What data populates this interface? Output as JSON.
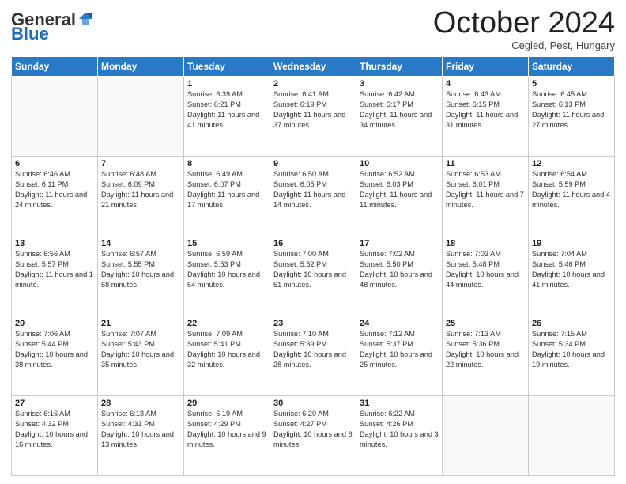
{
  "header": {
    "logo_general": "General",
    "logo_blue": "Blue",
    "month_title": "October 2024",
    "subtitle": "Cegled, Pest, Hungary"
  },
  "weekdays": [
    "Sunday",
    "Monday",
    "Tuesday",
    "Wednesday",
    "Thursday",
    "Friday",
    "Saturday"
  ],
  "weeks": [
    [
      {
        "day": "",
        "sunrise": "",
        "sunset": "",
        "daylight": ""
      },
      {
        "day": "",
        "sunrise": "",
        "sunset": "",
        "daylight": ""
      },
      {
        "day": "1",
        "sunrise": "Sunrise: 6:39 AM",
        "sunset": "Sunset: 6:21 PM",
        "daylight": "Daylight: 11 hours and 41 minutes."
      },
      {
        "day": "2",
        "sunrise": "Sunrise: 6:41 AM",
        "sunset": "Sunset: 6:19 PM",
        "daylight": "Daylight: 11 hours and 37 minutes."
      },
      {
        "day": "3",
        "sunrise": "Sunrise: 6:42 AM",
        "sunset": "Sunset: 6:17 PM",
        "daylight": "Daylight: 11 hours and 34 minutes."
      },
      {
        "day": "4",
        "sunrise": "Sunrise: 6:43 AM",
        "sunset": "Sunset: 6:15 PM",
        "daylight": "Daylight: 11 hours and 31 minutes."
      },
      {
        "day": "5",
        "sunrise": "Sunrise: 6:45 AM",
        "sunset": "Sunset: 6:13 PM",
        "daylight": "Daylight: 11 hours and 27 minutes."
      }
    ],
    [
      {
        "day": "6",
        "sunrise": "Sunrise: 6:46 AM",
        "sunset": "Sunset: 6:11 PM",
        "daylight": "Daylight: 11 hours and 24 minutes."
      },
      {
        "day": "7",
        "sunrise": "Sunrise: 6:48 AM",
        "sunset": "Sunset: 6:09 PM",
        "daylight": "Daylight: 11 hours and 21 minutes."
      },
      {
        "day": "8",
        "sunrise": "Sunrise: 6:49 AM",
        "sunset": "Sunset: 6:07 PM",
        "daylight": "Daylight: 11 hours and 17 minutes."
      },
      {
        "day": "9",
        "sunrise": "Sunrise: 6:50 AM",
        "sunset": "Sunset: 6:05 PM",
        "daylight": "Daylight: 11 hours and 14 minutes."
      },
      {
        "day": "10",
        "sunrise": "Sunrise: 6:52 AM",
        "sunset": "Sunset: 6:03 PM",
        "daylight": "Daylight: 11 hours and 11 minutes."
      },
      {
        "day": "11",
        "sunrise": "Sunrise: 6:53 AM",
        "sunset": "Sunset: 6:01 PM",
        "daylight": "Daylight: 11 hours and 7 minutes."
      },
      {
        "day": "12",
        "sunrise": "Sunrise: 6:54 AM",
        "sunset": "Sunset: 5:59 PM",
        "daylight": "Daylight: 11 hours and 4 minutes."
      }
    ],
    [
      {
        "day": "13",
        "sunrise": "Sunrise: 6:56 AM",
        "sunset": "Sunset: 5:57 PM",
        "daylight": "Daylight: 11 hours and 1 minute."
      },
      {
        "day": "14",
        "sunrise": "Sunrise: 6:57 AM",
        "sunset": "Sunset: 5:55 PM",
        "daylight": "Daylight: 10 hours and 58 minutes."
      },
      {
        "day": "15",
        "sunrise": "Sunrise: 6:59 AM",
        "sunset": "Sunset: 5:53 PM",
        "daylight": "Daylight: 10 hours and 54 minutes."
      },
      {
        "day": "16",
        "sunrise": "Sunrise: 7:00 AM",
        "sunset": "Sunset: 5:52 PM",
        "daylight": "Daylight: 10 hours and 51 minutes."
      },
      {
        "day": "17",
        "sunrise": "Sunrise: 7:02 AM",
        "sunset": "Sunset: 5:50 PM",
        "daylight": "Daylight: 10 hours and 48 minutes."
      },
      {
        "day": "18",
        "sunrise": "Sunrise: 7:03 AM",
        "sunset": "Sunset: 5:48 PM",
        "daylight": "Daylight: 10 hours and 44 minutes."
      },
      {
        "day": "19",
        "sunrise": "Sunrise: 7:04 AM",
        "sunset": "Sunset: 5:46 PM",
        "daylight": "Daylight: 10 hours and 41 minutes."
      }
    ],
    [
      {
        "day": "20",
        "sunrise": "Sunrise: 7:06 AM",
        "sunset": "Sunset: 5:44 PM",
        "daylight": "Daylight: 10 hours and 38 minutes."
      },
      {
        "day": "21",
        "sunrise": "Sunrise: 7:07 AM",
        "sunset": "Sunset: 5:43 PM",
        "daylight": "Daylight: 10 hours and 35 minutes."
      },
      {
        "day": "22",
        "sunrise": "Sunrise: 7:09 AM",
        "sunset": "Sunset: 5:41 PM",
        "daylight": "Daylight: 10 hours and 32 minutes."
      },
      {
        "day": "23",
        "sunrise": "Sunrise: 7:10 AM",
        "sunset": "Sunset: 5:39 PM",
        "daylight": "Daylight: 10 hours and 28 minutes."
      },
      {
        "day": "24",
        "sunrise": "Sunrise: 7:12 AM",
        "sunset": "Sunset: 5:37 PM",
        "daylight": "Daylight: 10 hours and 25 minutes."
      },
      {
        "day": "25",
        "sunrise": "Sunrise: 7:13 AM",
        "sunset": "Sunset: 5:36 PM",
        "daylight": "Daylight: 10 hours and 22 minutes."
      },
      {
        "day": "26",
        "sunrise": "Sunrise: 7:15 AM",
        "sunset": "Sunset: 5:34 PM",
        "daylight": "Daylight: 10 hours and 19 minutes."
      }
    ],
    [
      {
        "day": "27",
        "sunrise": "Sunrise: 6:16 AM",
        "sunset": "Sunset: 4:32 PM",
        "daylight": "Daylight: 10 hours and 16 minutes."
      },
      {
        "day": "28",
        "sunrise": "Sunrise: 6:18 AM",
        "sunset": "Sunset: 4:31 PM",
        "daylight": "Daylight: 10 hours and 13 minutes."
      },
      {
        "day": "29",
        "sunrise": "Sunrise: 6:19 AM",
        "sunset": "Sunset: 4:29 PM",
        "daylight": "Daylight: 10 hours and 9 minutes."
      },
      {
        "day": "30",
        "sunrise": "Sunrise: 6:20 AM",
        "sunset": "Sunset: 4:27 PM",
        "daylight": "Daylight: 10 hours and 6 minutes."
      },
      {
        "day": "31",
        "sunrise": "Sunrise: 6:22 AM",
        "sunset": "Sunset: 4:26 PM",
        "daylight": "Daylight: 10 hours and 3 minutes."
      },
      {
        "day": "",
        "sunrise": "",
        "sunset": "",
        "daylight": ""
      },
      {
        "day": "",
        "sunrise": "",
        "sunset": "",
        "daylight": ""
      }
    ]
  ]
}
